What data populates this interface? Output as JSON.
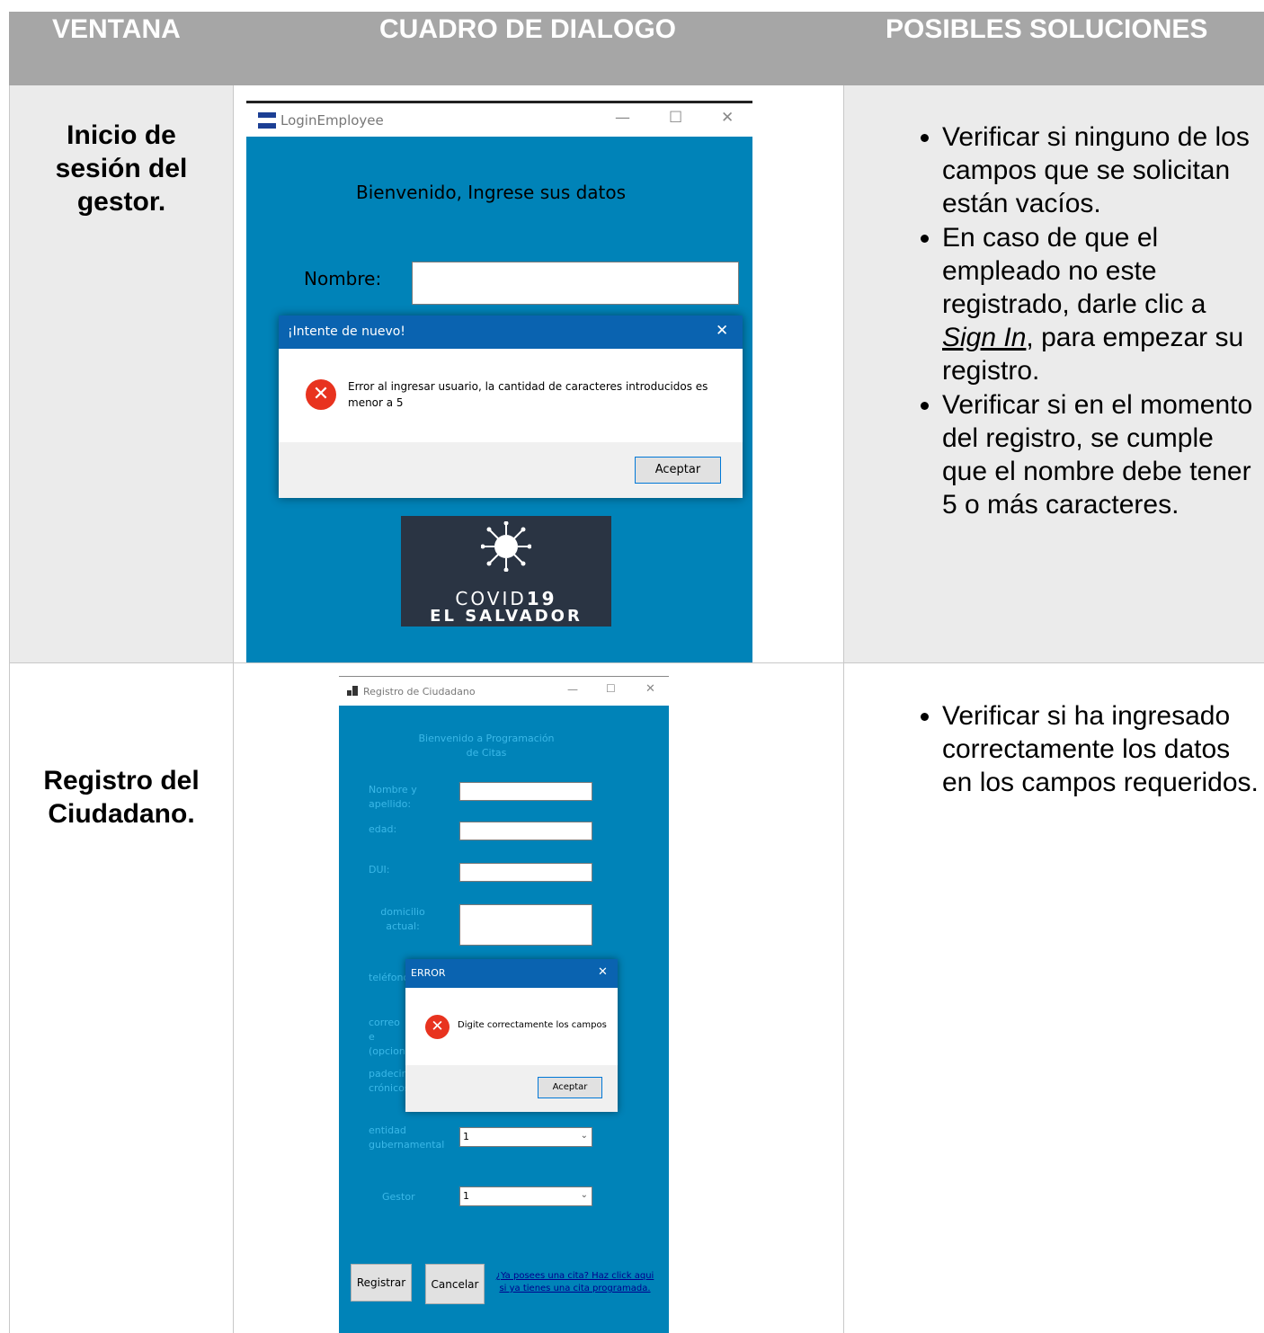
{
  "table": {
    "headers": [
      "VENTANA",
      "CUADRO DE DIALOGO",
      "POSIBLES SOLUCIONES"
    ],
    "rows": [
      {
        "title": "Inicio de sesión del gestor.",
        "solutions": [
          "Verificar si ninguno de los campos que se solicitan están vacíos.",
          {
            "pre": "En caso de que el empleado no este registrado, darle clic a ",
            "link": "Sign In",
            "post": ", para empezar su registro."
          },
          "Verificar si en el momento del registro, se cumple que el nombre debe tener 5 o más caracteres."
        ]
      },
      {
        "title": "Registro del Ciudadano.",
        "solutions": [
          "Verificar si ha ingresado correctamente los datos en los campos requeridos."
        ]
      }
    ]
  },
  "login_window": {
    "title": "LoginEmployee",
    "welcome": "Bienvenido, Ingrese sus datos",
    "name_label": "Nombre:",
    "dialog": {
      "title": "¡Intente de nuevo!",
      "message": "Error al ingresar usuario, la cantidad de caracteres introducidos es menor a 5",
      "button": "Aceptar"
    },
    "logo": {
      "line1": "COVID",
      "line1_bold": "19",
      "line2": "EL SALVADOR"
    }
  },
  "register_window": {
    "title": "Registro de Ciudadano",
    "welcome": "Bienvenido a Programación de Citas",
    "labels": {
      "name": "Nombre y apellido:",
      "age": "edad:",
      "dui": "DUI:",
      "address": "domicilio actual:",
      "phone": "teléfono",
      "email": "correo e (opcion",
      "conditions": "padecim crónicos",
      "entity": "entidad gubernamental",
      "manager": "Gestor"
    },
    "entity_value": "1",
    "manager_value": "1",
    "register_button": "Registrar",
    "cancel_button": "Cancelar",
    "link": "¿Ya posees una cita? Haz click aqui si ya tienes una cita programada.",
    "dialog": {
      "title": "ERROR",
      "message": "Digite correctamente los campos",
      "button": "Aceptar"
    }
  }
}
